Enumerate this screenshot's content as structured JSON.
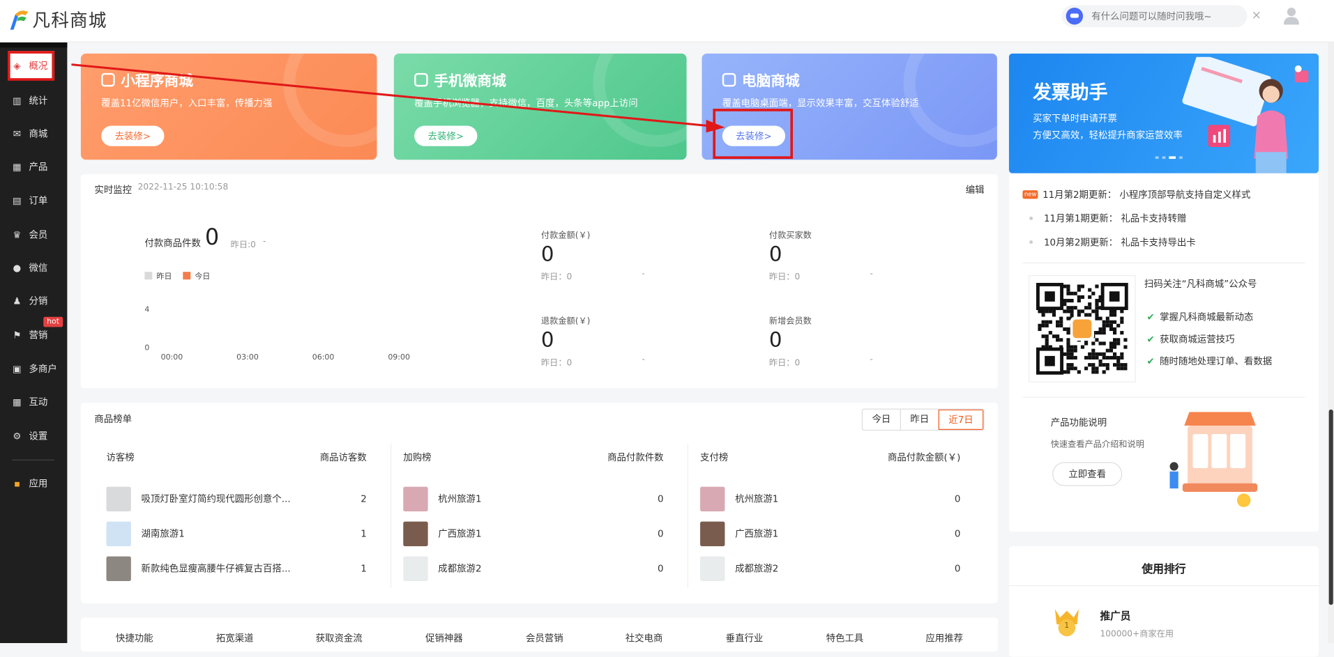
{
  "app": {
    "name": "凡科商城"
  },
  "header": {
    "assistant_placeholder": "有什么问题可以随时问我哦~",
    "close_glyph": "×"
  },
  "sidebar": {
    "items": [
      {
        "label": "概况",
        "icon": "layers-icon",
        "glyph": "◈",
        "active": true
      },
      {
        "label": "统计",
        "icon": "bar-chart-icon",
        "glyph": "▥"
      },
      {
        "label": "商城",
        "icon": "mail-icon",
        "glyph": "✉"
      },
      {
        "label": "产品",
        "icon": "grid-icon",
        "glyph": "▦"
      },
      {
        "label": "订单",
        "icon": "clipboard-icon",
        "glyph": "▤"
      },
      {
        "label": "会员",
        "icon": "crown-icon",
        "glyph": "♛"
      },
      {
        "label": "微信",
        "icon": "wechat-icon",
        "glyph": "●"
      },
      {
        "label": "分销",
        "icon": "users-icon",
        "glyph": "♟"
      },
      {
        "label": "营销",
        "icon": "flag-icon",
        "glyph": "⚑"
      },
      {
        "label": "多商户",
        "icon": "store-icon",
        "glyph": "▣"
      },
      {
        "label": "互动",
        "icon": "apps-icon",
        "glyph": "▦"
      },
      {
        "label": "设置",
        "icon": "gear-icon",
        "glyph": "⚙"
      },
      {
        "label": "应用",
        "icon": "app-center-icon",
        "glyph": "▪"
      }
    ],
    "hot_badge": "hot"
  },
  "banners": [
    {
      "title": "小程序商城",
      "desc": "覆盖11亿微信用户，入口丰富，传播力强",
      "button": "去装修>",
      "color_from": "#ff9d6c",
      "color_to": "#fb8a55",
      "btn_color": "#f76d35"
    },
    {
      "title": "手机微商城",
      "desc": "覆盖手机浏览器，支持微信，百度，头条等app上访问",
      "button": "去装修>",
      "color_from": "#7adba9",
      "color_to": "#4ec78c",
      "btn_color": "#34b476"
    },
    {
      "title": "电脑商城",
      "desc": "覆盖电脑桌面端，显示效果丰富，交互体验舒适",
      "button": "去装修>",
      "color_from": "#96b4fb",
      "color_to": "#7b97f6",
      "btn_color": "#5878ee"
    }
  ],
  "promo": {
    "title": "发票助手",
    "line1": "买家下单时申请开票",
    "line2": "方便又高效，轻松提升商家运营效率"
  },
  "monitor": {
    "title": "实时监控",
    "time": "2022-11-25 10:10:58",
    "edit": "编辑",
    "paid_items_label": "付款商品件数",
    "paid_items_value": "0",
    "paid_items_yesterday": "昨日:0",
    "paid_items_dash": "-",
    "legend_yesterday": "昨日",
    "legend_today": "今日",
    "y_ticks": [
      "4",
      "0"
    ],
    "x_ticks": [
      "00:00",
      "03:00",
      "06:00",
      "09:00"
    ],
    "kpis": [
      {
        "label": "付款金额(￥)",
        "value": "0",
        "yesterday": "昨日：0",
        "dash": "-"
      },
      {
        "label": "付款买家数",
        "value": "0",
        "yesterday": "昨日：0",
        "dash": "-"
      },
      {
        "label": "退款金额(￥)",
        "value": "0",
        "yesterday": "昨日：0",
        "dash": "-"
      },
      {
        "label": "新增会员数",
        "value": "0",
        "yesterday": "昨日：0",
        "dash": "-"
      }
    ]
  },
  "ranking": {
    "title": "商品榜单",
    "tabs": [
      "今日",
      "昨日",
      "近7日"
    ],
    "active_tab": "近7日",
    "columns": [
      {
        "title": "访客榜",
        "metric": "商品访客数",
        "rows": [
          {
            "name": "吸顶灯卧室灯简约现代圆形创意个...",
            "value": "2",
            "thumb": "#d9dadc"
          },
          {
            "name": "湖南旅游1",
            "value": "1",
            "thumb": "#cfe3f5"
          },
          {
            "name": "新款纯色显瘦高腰牛仔裤复古百搭...",
            "value": "1",
            "thumb": "#8c8780"
          }
        ]
      },
      {
        "title": "加购榜",
        "metric": "商品付款件数",
        "rows": [
          {
            "name": "杭州旅游1",
            "value": "0",
            "thumb": "#d8a9b3"
          },
          {
            "name": "广西旅游1",
            "value": "0",
            "thumb": "#7a5c4e"
          },
          {
            "name": "成都旅游2",
            "value": "0",
            "thumb": "#e8ecec"
          }
        ]
      },
      {
        "title": "支付榜",
        "metric": "商品付款金额(￥)",
        "rows": [
          {
            "name": "杭州旅游1",
            "value": "0",
            "thumb": "#d8a9b3"
          },
          {
            "name": "广西旅游1",
            "value": "0",
            "thumb": "#7a5c4e"
          },
          {
            "name": "成都旅游2",
            "value": "0",
            "thumb": "#e8ecec"
          }
        ]
      }
    ]
  },
  "quick_tabs": [
    "快捷功能",
    "拓宽渠道",
    "获取资金流",
    "促销神器",
    "会员营销",
    "社交电商",
    "垂直行业",
    "特色工具",
    "应用推荐"
  ],
  "updates": [
    {
      "badge": "new",
      "text": "11月第2期更新： 小程序顶部导航支持自定义样式"
    },
    {
      "text": "11月第1期更新： 礼品卡支持转赠"
    },
    {
      "text": "10月第2期更新： 礼品卡支持导出卡"
    }
  ],
  "follow": {
    "title": "扫码关注“凡科商城”公众号",
    "checks": [
      "掌握凡科商城最新动态",
      "获取商城运营技巧",
      "随时随地处理订单、看数据"
    ]
  },
  "product_intro": {
    "title": "产品功能说明",
    "desc": "快速查看产品介绍和说明",
    "button": "立即查看"
  },
  "usage": {
    "title": "使用排行",
    "item_title": "推广员",
    "item_sub": "100000+商家在用",
    "medal": "1"
  }
}
